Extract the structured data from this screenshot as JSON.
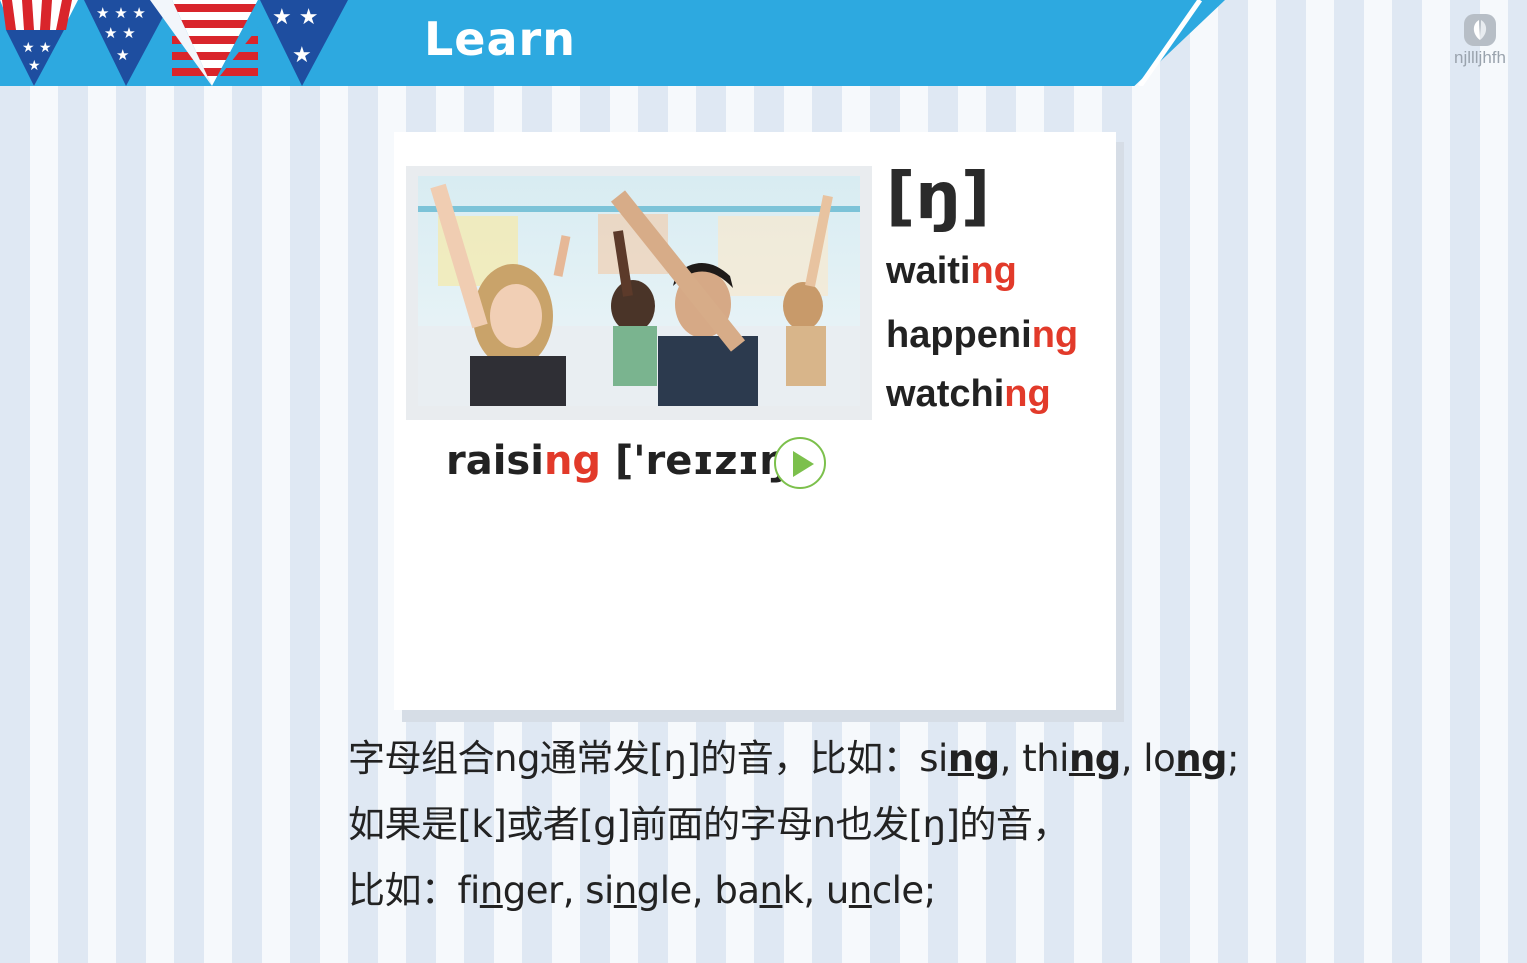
{
  "header": {
    "title": "Learn",
    "logo_text": "njllljhfh",
    "band_color": "#2da9e0"
  },
  "card": {
    "phonetic": "[ŋ]",
    "words": [
      {
        "base": "waiti",
        "ending": "ng"
      },
      {
        "base": "happeni",
        "ending": "ng"
      },
      {
        "base": "watchi",
        "ending": "ng"
      }
    ],
    "example": {
      "base": "raisi",
      "ending": "ng",
      "transcription": " ['reɪzɪŋ]"
    },
    "highlight_color": "#e23a2a",
    "play_icon": "play-icon"
  },
  "notes": {
    "line1": {
      "prefix": "字母组合ng通常发[ŋ]的音，比如：",
      "examples": [
        {
          "before": "si",
          "under": "ng",
          "after": ", "
        },
        {
          "before": "thi",
          "under": "ng",
          "after": ", "
        },
        {
          "before": "lo",
          "under": "ng",
          "after": ";"
        }
      ]
    },
    "line2": "如果是[k]或者[g]前面的字母n也发[ŋ]的音，",
    "line3": {
      "prefix": "比如：",
      "examples": [
        {
          "before": "fi",
          "under": "n",
          "after": "ger, "
        },
        {
          "before": "si",
          "under": "n",
          "after": "gle, "
        },
        {
          "before": "ba",
          "under": "n",
          "after": "k, "
        },
        {
          "before": "u",
          "under": "n",
          "after": "cle;"
        }
      ]
    }
  }
}
